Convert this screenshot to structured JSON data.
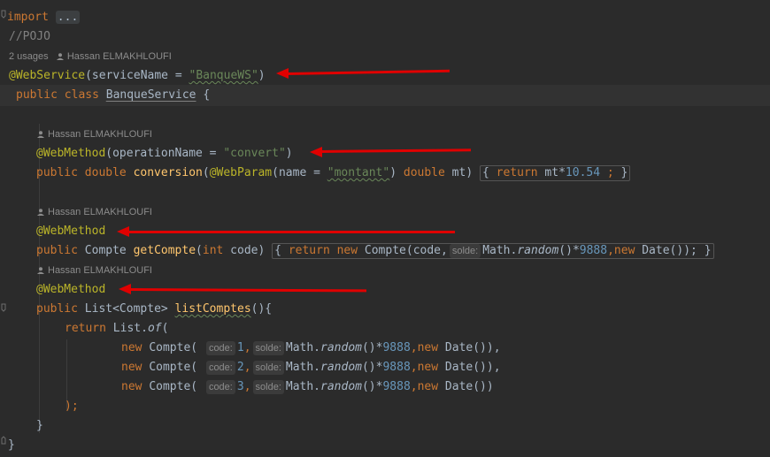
{
  "code": {
    "import_kw": "import",
    "import_fold": "...",
    "pojo_comment": "//POJO",
    "usages": "2 usages",
    "author": "Hassan ELMAKHLOUFI",
    "ws_annotation": "@WebService",
    "ws_param_open": "(serviceName = ",
    "ws_param_value": "\"BanqueWS\"",
    "ws_param_close": ")",
    "class_kw": "public class ",
    "class_name": "BanqueService",
    "class_brace": " {",
    "wm1_annotation": "@WebMethod",
    "wm1_param_open": "(operationName = ",
    "wm1_param_value": "\"convert\"",
    "wm1_param_close": ")",
    "conv_kw": "public double ",
    "conv_name": "conversion",
    "conv_paren": "(",
    "conv_webparam": "@WebParam",
    "conv_name_eq": "(name = ",
    "conv_name_val": "\"montant\"",
    "conv_tail1": ") ",
    "conv_double": "double",
    "conv_mt": " mt) ",
    "conv_ob": "{ ",
    "conv_return": "return",
    "conv_expr": " mt*",
    "conv_num": "10.54",
    "conv_semi": " ;",
    "conv_cb": " }",
    "wm2_annotation": "@WebMethod",
    "gc_public": "public ",
    "gc_type": "Compte ",
    "gc_name": "getCompte",
    "gc_open": "(",
    "gc_int": "int",
    "gc_code": " code) ",
    "gc_ob": "{ ",
    "gc_return": "return new ",
    "gc_new": "Compte(code,",
    "hint_solde": "solde:",
    "gc_math": "Math.",
    "gc_random": "random",
    "gc_mult": "()*",
    "gc_num": "9888",
    "gc_comma": ",",
    "gc_new2": "new ",
    "gc_date": "Date()); ",
    "gc_cb": "}",
    "wm3_annotation": "@WebMethod",
    "lc_public": "public ",
    "lc_type": "List<Compte> ",
    "lc_name": "listComptes",
    "lc_open": "(){",
    "ret_kw": "return ",
    "ret_list": "List.",
    "ret_of": "of",
    "ret_paren": "(",
    "new_kw": "new ",
    "compte_open": "Compte( ",
    "hint_code": "code:",
    "num_1": "1",
    "num_2": "2",
    "num_3": "3",
    "comma": ",",
    "math": "Math.",
    "random": "random",
    "mult": "()*",
    "num_9888": "9888",
    "date_end1": "Date()),",
    "date_end3": "Date())",
    "close_paren": ");",
    "close_method": "}",
    "close_class": "}"
  },
  "colors": {
    "background": "#2b2b2b",
    "keyword": "#cc7832",
    "annotation": "#bbb529",
    "string": "#6a8759",
    "number": "#6897bb",
    "function": "#ffc66d",
    "text": "#a9b7c6",
    "comment": "#808080",
    "arrow": "#e00000"
  },
  "icons": [
    "user-icon",
    "fold-icon"
  ]
}
